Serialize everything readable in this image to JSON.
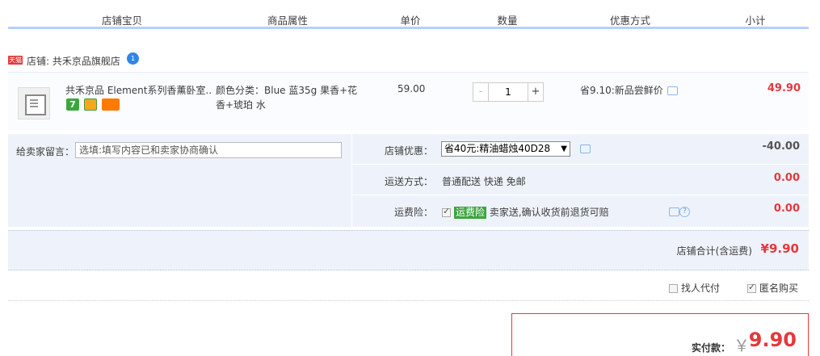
{
  "header": {
    "col_shop_item": "店铺宝贝",
    "col_attrs": "商品属性",
    "col_price": "单价",
    "col_qty": "数量",
    "col_promo": "优惠方式",
    "col_subtotal": "小计"
  },
  "shop": {
    "tmall_badge": "天猫",
    "name": "店铺: 共禾京品旗舰店",
    "wangwang_badge": "1"
  },
  "item": {
    "title": "共禾京品 Element系列香薰卧室...",
    "badge_7": "7",
    "attrs": "颜色分类：Blue 蓝35g 果香+花香+琥珀 水",
    "price": "59.00",
    "qty_minus": "-",
    "qty": "1",
    "qty_plus": "+",
    "promo": "省9.10:新品尝鲜价",
    "subtotal": "49.90"
  },
  "extras": {
    "message_label": "给卖家留言：",
    "message_placeholder": "选填:填写内容已和卖家协商确认",
    "shop_discount_label": "店铺优惠：",
    "shop_discount_value": "省40元:精油蜡烛40D28",
    "shop_discount_arrow": "▼",
    "shop_discount_amount": "-40.00",
    "shipping_label": "运送方式：",
    "shipping_value": "普通配送 快递 免邮",
    "shipping_amount": "0.00",
    "insurance_label": "运费险：",
    "insurance_tag": "运费险",
    "insurance_text": "卖家送,确认收货前退货可赔",
    "insurance_help": "?",
    "insurance_amount": "0.00"
  },
  "total": {
    "label": "店铺合计(含运费)",
    "value": "¥9.90"
  },
  "options": {
    "proxy_pay": "找人代付",
    "anonymous": "匿名购买"
  },
  "pay": {
    "label": "实付款：",
    "yen": "￥",
    "value": "9.90"
  }
}
